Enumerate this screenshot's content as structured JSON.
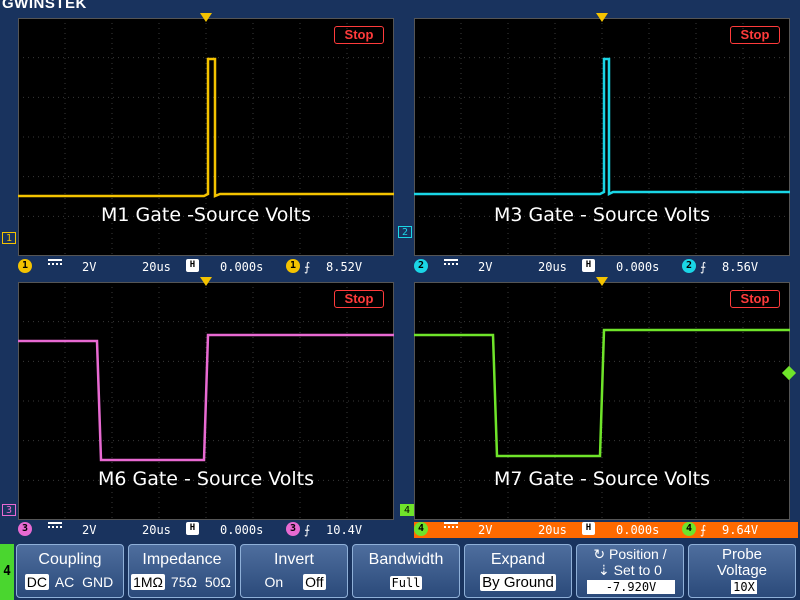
{
  "brand": "GWINSTEK",
  "stop_label": "Stop",
  "panels": [
    {
      "channel": "1",
      "label": "M1 Gate -Source Volts",
      "color": "#f4c300",
      "volts_div": "2V",
      "time_div": "20us",
      "offset": "0.000s",
      "trigger_level": "8.52V"
    },
    {
      "channel": "2",
      "label": "M3 Gate - Source Volts",
      "color": "#1ad6e6",
      "volts_div": "2V",
      "time_div": "20us",
      "offset": "0.000s",
      "trigger_level": "8.56V"
    },
    {
      "channel": "3",
      "label": "M6 Gate - Source Volts",
      "color": "#e86ad2",
      "volts_div": "2V",
      "time_div": "20us",
      "offset": "0.000s",
      "trigger_level": "10.4V"
    },
    {
      "channel": "4",
      "label": "M7 Gate - Source Volts",
      "color": "#6fe42a",
      "volts_div": "2V",
      "time_div": "20us",
      "offset": "0.000s",
      "trigger_level": "9.64V"
    }
  ],
  "menu": {
    "channel_tab": "4",
    "coupling": {
      "title": "Coupling",
      "options": [
        "DC",
        "AC",
        "GND"
      ],
      "selected": "DC"
    },
    "impedance": {
      "title": "Impedance",
      "options": [
        "1MΩ",
        "75Ω",
        "50Ω"
      ],
      "selected": "1MΩ"
    },
    "invert": {
      "title": "Invert",
      "options": [
        "On",
        "Off"
      ],
      "selected": "Off"
    },
    "bandwidth": {
      "title": "Bandwidth",
      "value": "Full"
    },
    "expand": {
      "title": "Expand",
      "value": "By Ground"
    },
    "position": {
      "title": "Position /",
      "subtitle": "Set to 0",
      "value": "-7.920V"
    },
    "probe": {
      "title": "Probe",
      "subtitle": "Voltage",
      "value": "10X"
    }
  }
}
